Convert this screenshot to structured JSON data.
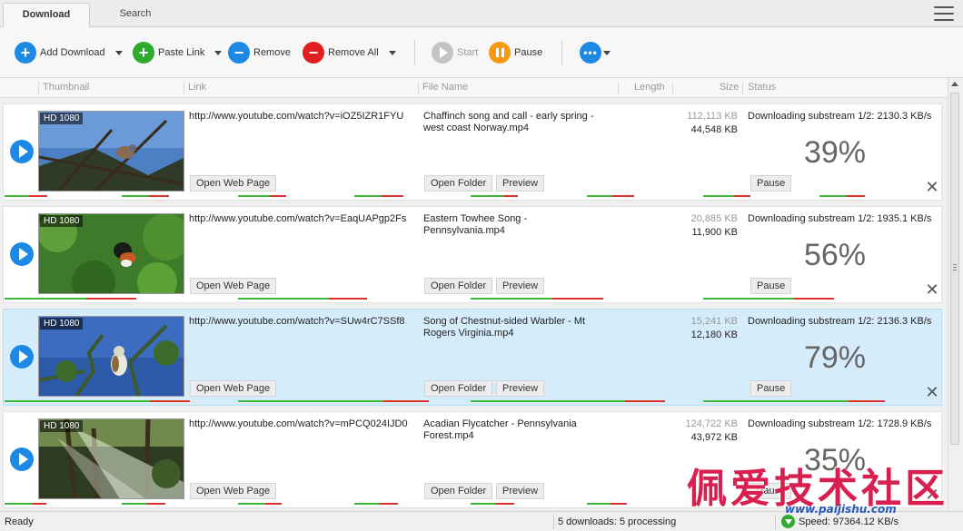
{
  "tabs": [
    {
      "label": "Download",
      "active": true
    },
    {
      "label": "Search",
      "active": false
    }
  ],
  "toolbar": {
    "add_download": "Add Download",
    "paste_link": "Paste Link",
    "remove": "Remove",
    "remove_all": "Remove All",
    "start": "Start",
    "pause": "Pause"
  },
  "columns": {
    "thumbnail": "Thumbnail",
    "link": "Link",
    "file_name": "File Name",
    "length": "Length",
    "size": "Size",
    "status": "Status"
  },
  "downloads": [
    {
      "badge": "HD 1080",
      "link": "http://www.youtube.com/watch?v=iOZ5IZR1FYU",
      "file_name": "Chaffinch song and call - early spring - west coast Norway.mp4",
      "total_size": "112,113 KB",
      "downloaded_size": "44,548 KB",
      "status": "Downloading substream 1/2: 2130.3 KB/s",
      "percent": "39%",
      "progress": 0.39,
      "open_web_page": "Open Web Page",
      "open_folder": "Open Folder",
      "preview": "Preview",
      "pause": "Pause"
    },
    {
      "badge": "HD 1080",
      "link": "http://www.youtube.com/watch?v=EaqUAPgp2Fs",
      "file_name": "Eastern Towhee Song - Pennsylvania.mp4",
      "total_size": "20,885 KB",
      "downloaded_size": "11,900 KB",
      "status": "Downloading substream 1/2: 1935.1 KB/s",
      "percent": "56%",
      "progress": 0.56,
      "open_web_page": "Open Web Page",
      "open_folder": "Open Folder",
      "preview": "Preview",
      "pause": "Pause"
    },
    {
      "badge": "HD 1080",
      "link": "http://www.youtube.com/watch?v=SUw4rC7SSf8",
      "file_name": "Song of Chestnut-sided Warbler - Mt Rogers Virginia.mp4",
      "total_size": "15,241 KB",
      "downloaded_size": "12,180 KB",
      "status": "Downloading substream 1/2: 2136.3 KB/s",
      "percent": "79%",
      "progress": 0.79,
      "open_web_page": "Open Web Page",
      "open_folder": "Open Folder",
      "preview": "Preview",
      "pause": "Pause"
    },
    {
      "badge": "HD 1080",
      "link": "http://www.youtube.com/watch?v=mPCQ024IJD0",
      "file_name": "Acadian Flycatcher - Pennsylvania Forest.mp4",
      "total_size": "124,722 KB",
      "downloaded_size": "43,972 KB",
      "status": "Downloading substream 1/2: 1728.9 KB/s",
      "percent": "35%",
      "progress": 0.35,
      "open_web_page": "Open Web Page",
      "open_folder": "Open Folder",
      "preview": "Preview",
      "pause": "Pause"
    }
  ],
  "statusbar": {
    "ready": "Ready",
    "downloads": "5 downloads: 5 processing",
    "speed": "Speed: 97364.12 KB/s"
  },
  "watermark": {
    "text": "佩爱技术社区",
    "url": "www.paijishu.com"
  },
  "colors": {
    "accent_blue": "#1e88e5",
    "selected_row": "#d5ecfa",
    "progress_green": "#3db83d",
    "progress_red": "#e03030",
    "watermark_red": "#d81f4f"
  }
}
